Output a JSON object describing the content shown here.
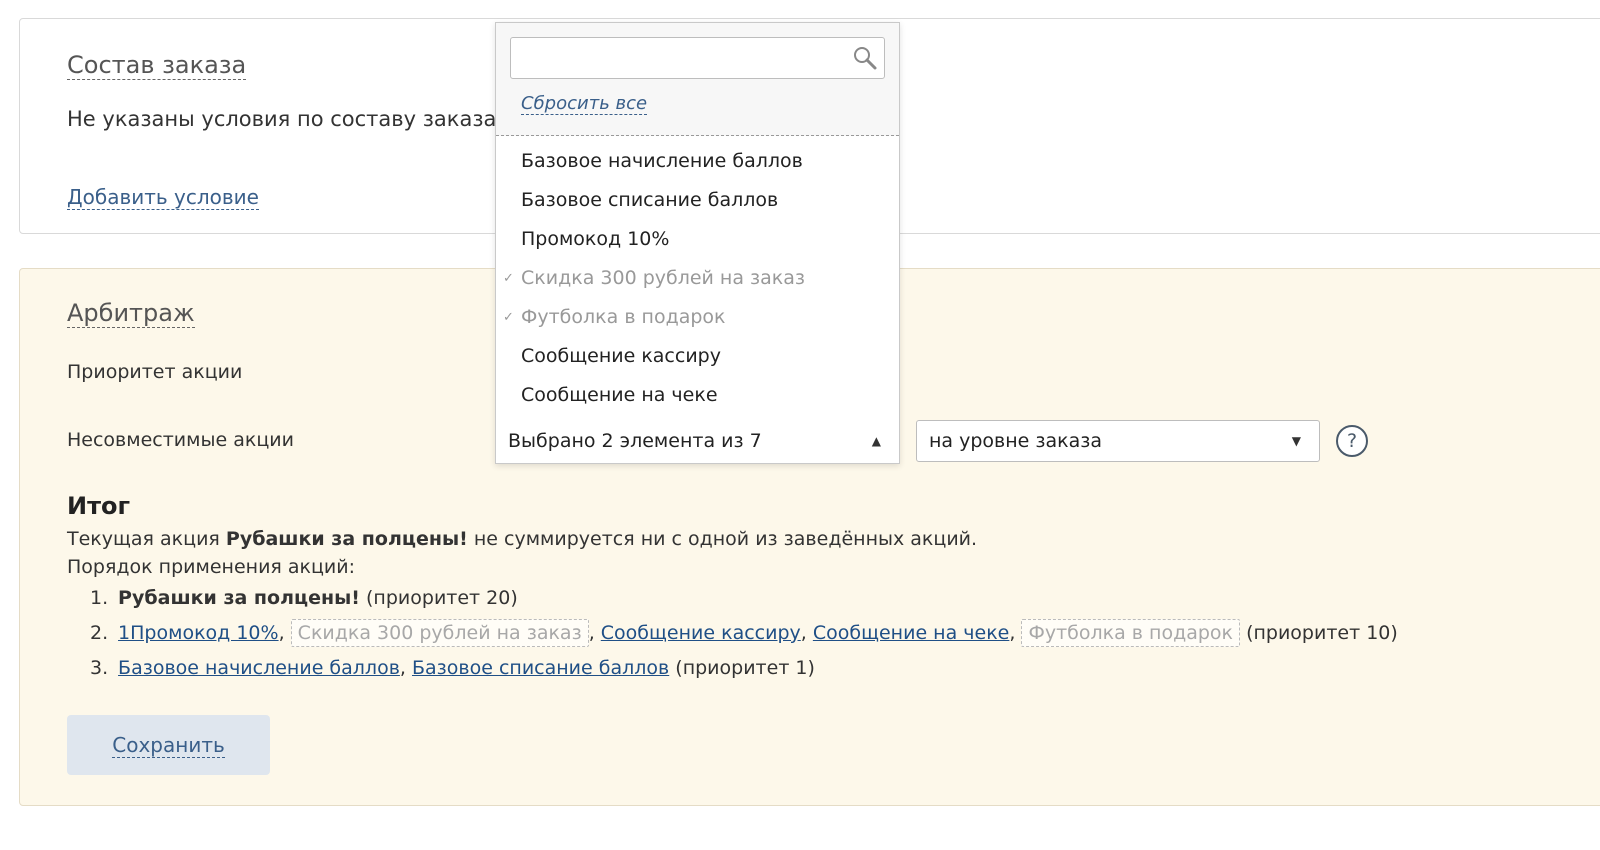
{
  "order_panel": {
    "title": "Состав заказа",
    "empty_text": "Не указаны условия по составу заказа",
    "add_condition": "Добавить условие"
  },
  "arbitrage": {
    "title": "Арбитраж",
    "priority_label": "Приоритет акции",
    "incompatible_label": "Несовместимые акции",
    "level_select": {
      "value": "на уровне заказа"
    },
    "help": "?"
  },
  "dropdown": {
    "search_placeholder": "",
    "reset_all": "Сбросить все",
    "options": [
      {
        "label": "Базовое начисление баллов",
        "checked": false
      },
      {
        "label": "Базовое списание баллов",
        "checked": false
      },
      {
        "label": "Промокод 10%",
        "checked": false
      },
      {
        "label": "Скидка 300 рублей на заказ",
        "checked": true
      },
      {
        "label": "Футболка в подарок",
        "checked": true
      },
      {
        "label": "Сообщение кассиру",
        "checked": false
      },
      {
        "label": "Сообщение на чеке",
        "checked": false
      }
    ],
    "check_mark": "✓",
    "selected_summary": "Выбрано 2 элемента из 7"
  },
  "result": {
    "heading": "Итог",
    "text_before": "Текущая акция ",
    "promo_name": "Рубашки за полцены!",
    "text_after": " не суммируется ни с одной из заведённых акций.",
    "order_label": "Порядок применения акций:",
    "items": [
      {
        "num": "1.",
        "name": "Рубашки за полцены!",
        "priority": "(приоритет 20)"
      },
      {
        "num": "2.",
        "link1": "1Промокод 10%",
        "chip1": "Скидка 300 рублей на заказ",
        "link2": "Сообщение кассиру",
        "link3": "Сообщение на чеке",
        "chip2": "Футболка в подарок",
        "priority": "(приоритет 10)"
      },
      {
        "num": "3.",
        "link1": "Базовое начисление баллов",
        "link2": "Базовое списание баллов",
        "priority": "(приоритет 1)"
      }
    ]
  },
  "save_button": "Сохранить"
}
